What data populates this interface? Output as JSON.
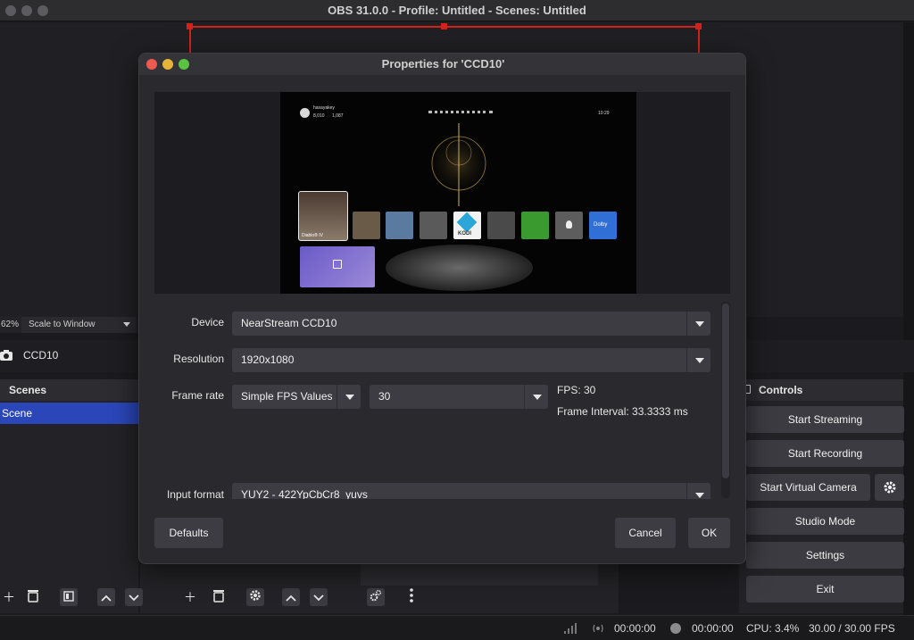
{
  "window": {
    "title": "OBS 31.0.0 - Profile: Untitled - Scenes: Untitled"
  },
  "preview": {
    "zoom_label": "62%",
    "scale_mode": "Scale to Window"
  },
  "source": {
    "name": "CCD10"
  },
  "scenes": {
    "header": "Scenes",
    "items": [
      "Scene"
    ]
  },
  "controls": {
    "header": "Controls",
    "start_streaming": "Start Streaming",
    "start_recording": "Start Recording",
    "start_virtual_camera": "Start Virtual Camera",
    "studio_mode": "Studio Mode",
    "settings": "Settings",
    "exit": "Exit"
  },
  "status": {
    "stream_time": "00:00:00",
    "record_time": "00:00:00",
    "cpu": "CPU: 3.4%",
    "fps": "30.00 / 30.00 FPS"
  },
  "dialog": {
    "title": "Properties for 'CCD10'",
    "device_label": "Device",
    "device_value": "NearStream CCD10",
    "resolution_label": "Resolution",
    "resolution_value": "1920x1080",
    "framerate_label": "Frame rate",
    "framerate_mode": "Simple FPS Values",
    "framerate_value": "30",
    "fps_info": "FPS: 30",
    "frame_interval": "Frame Interval: 33.3333 ms",
    "input_format_label": "Input format",
    "input_format_value": "YUY2 - 422YpCbCr8_yuvs",
    "defaults_button": "Defaults",
    "cancel_button": "Cancel",
    "ok_button": "OK"
  },
  "console": {
    "username": "hasayakey",
    "gamerscore": "8,010",
    "followers": "1,087",
    "clock": "10:29",
    "tiles": [
      "Diablo® IV",
      "KODI",
      "Dolby"
    ]
  },
  "colors": {
    "accent_scene": "#2a46b8",
    "selection_red": "#d4221a",
    "kodi_green": "#3a9a2f",
    "dolby_blue": "#2f6fd6"
  }
}
